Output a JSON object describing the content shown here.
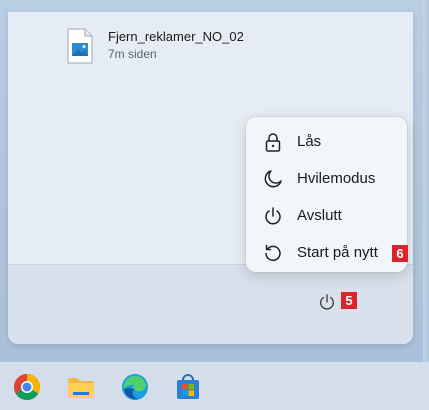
{
  "recent": {
    "file_name": "Fjern_reklamer_NO_02",
    "time": "7m siden"
  },
  "power_menu": {
    "items": [
      {
        "label": "Lås",
        "icon": "lock-icon"
      },
      {
        "label": "Hvilemodus",
        "icon": "moon-icon"
      },
      {
        "label": "Avslutt",
        "icon": "power-icon"
      },
      {
        "label": "Start på nytt",
        "icon": "restart-icon"
      }
    ]
  },
  "badges": {
    "restart": "6",
    "power": "5"
  },
  "taskbar": {
    "apps": [
      "chrome-icon",
      "file-explorer-icon",
      "edge-icon",
      "microsoft-store-icon"
    ]
  },
  "colors": {
    "badge": "#d8242a",
    "menu_bg": "#f2f5f9",
    "panel_bg": "#e3e9f2"
  }
}
